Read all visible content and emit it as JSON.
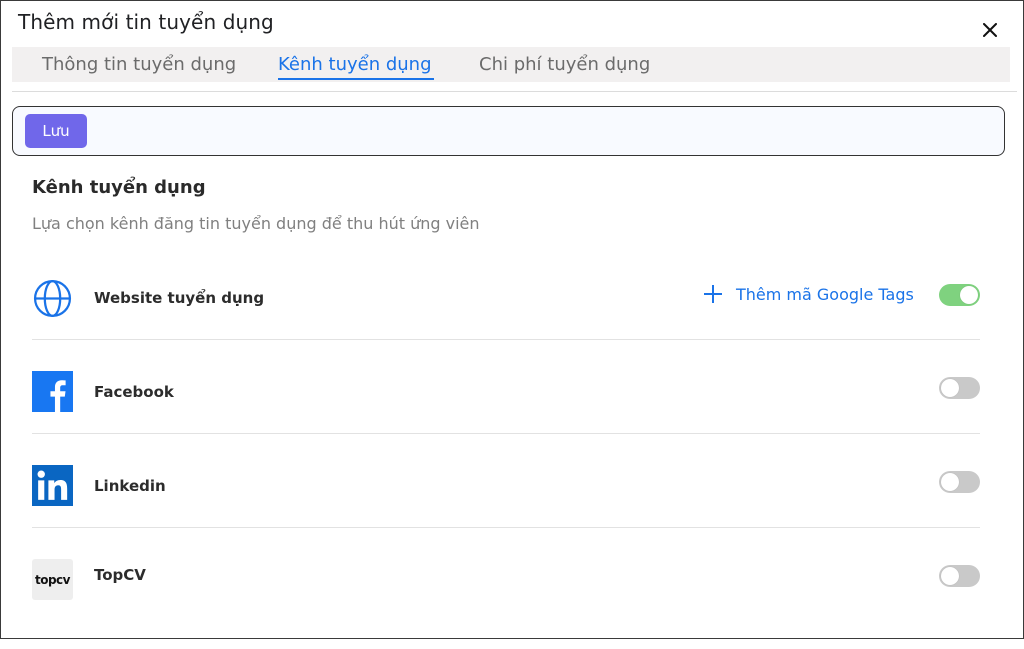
{
  "dialog": {
    "title": "Thêm mới tin tuyển dụng",
    "close_icon": "close-icon"
  },
  "tabs": [
    {
      "label": "Thông tin tuyển dụng",
      "active": false
    },
    {
      "label": "Kênh tuyển dụng",
      "active": true
    },
    {
      "label": "Chi phí tuyển dụng",
      "active": false
    }
  ],
  "toolbar": {
    "save_label": "Lưu"
  },
  "section": {
    "title": "Kênh tuyển dụng",
    "subtitle": "Lựa chọn kênh đăng tin tuyển dụng để thu hút ứng viên"
  },
  "channels": [
    {
      "name": "Website tuyển dụng",
      "icon": "globe-icon",
      "enabled": true,
      "action_label": "Thêm mã Google Tags"
    },
    {
      "name": "Facebook",
      "icon": "facebook-icon",
      "enabled": false
    },
    {
      "name": "Linkedin",
      "icon": "linkedin-icon",
      "enabled": false
    },
    {
      "name": "TopCV",
      "icon": "topcv-icon",
      "enabled": false,
      "logo_text": "topcv"
    }
  ],
  "colors": {
    "accent": "#1a73e8",
    "primary_button": "#7067ea",
    "toggle_on": "#7fd27f",
    "toggle_off": "#c9c9c9",
    "facebook": "#1877f2",
    "linkedin": "#0a66c2"
  }
}
